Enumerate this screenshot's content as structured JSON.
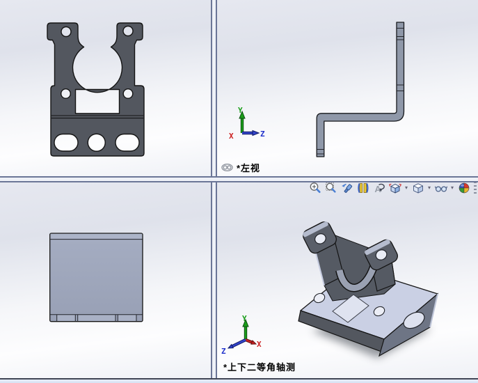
{
  "viewports": {
    "top_left": {
      "view_name": "front-view"
    },
    "top_right": {
      "view_name": "left-view",
      "label": "*左视",
      "linked": true
    },
    "bottom_left": {
      "view_name": "top-view"
    },
    "bottom_right": {
      "view_name": "isometric-view",
      "label": "*上下二等角轴测",
      "active": true
    }
  },
  "triad": {
    "x_label": "X",
    "y_label": "Y",
    "z_label": "Z",
    "x_color": "#cc2020",
    "y_color": "#1a9e1a",
    "z_color": "#2233cc"
  },
  "heads_up_toolbar": {
    "icons": [
      {
        "name": "zoom-to-fit-icon"
      },
      {
        "name": "zoom-to-area-icon"
      },
      {
        "name": "previous-view-icon"
      },
      {
        "name": "section-view-icon"
      },
      {
        "name": "rotate-view-icon"
      },
      {
        "name": "view-orientation-icon",
        "has_dropdown": true
      },
      {
        "name": "display-style-icon",
        "has_dropdown": true
      },
      {
        "name": "hide-show-items-icon",
        "has_dropdown": true
      },
      {
        "name": "edit-appearance-icon"
      }
    ]
  },
  "icon_glyphs": {
    "dropdown_chevron": "▾",
    "link_icon": "chain-link"
  },
  "colors": {
    "part_front_fill": "#53575f",
    "part_edge_fill": "#8f98a9",
    "part_top_fill": "#9ca4b9",
    "part_iso_top": "#cad0e4",
    "part_iso_side": "#6e7585",
    "outline": "#141414",
    "splitter_line": "#6b7697",
    "status_bar": "#d6e0f3",
    "appearance_ball": [
      "#3555bb",
      "#d8382c",
      "#379a37",
      "#e9b42e"
    ]
  }
}
